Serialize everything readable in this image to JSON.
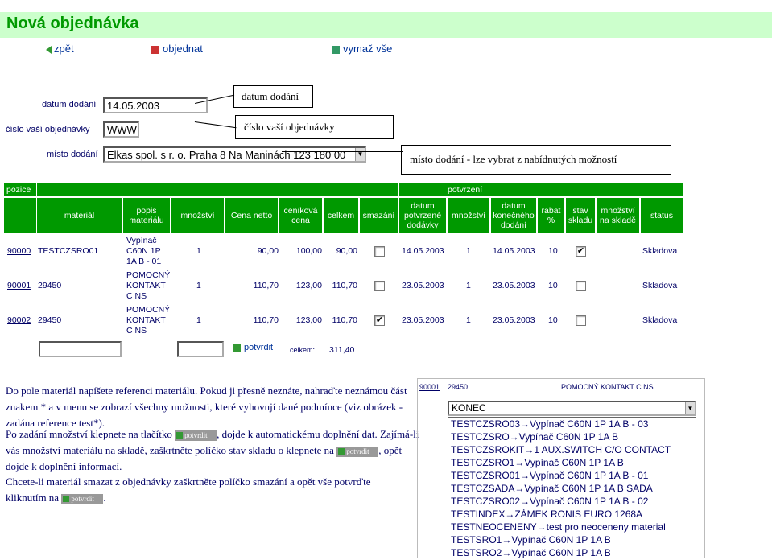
{
  "page": {
    "title": "Nová objednávka"
  },
  "toolbar": {
    "back": "zpět",
    "order": "objednat",
    "clear": "vymaž vše"
  },
  "form": {
    "delivery_date_label": "datum dodání",
    "delivery_date": "14.05.2003",
    "your_order_label": "číslo vaší objednávky",
    "your_order": "WWW",
    "place_label": "místo dodání",
    "place": "Elkas spol. s r. o. Praha 8 Na Maninách 123 180 00"
  },
  "callouts": {
    "date": "datum dodání",
    "order": "číslo vaší objednávky",
    "place": "místo dodání - lze vybrat z nabídnutých možností"
  },
  "table": {
    "header_top": {
      "pozice": "pozice",
      "potvrzeni": "potvrzení"
    },
    "columns": [
      "materiál",
      "popis materiálu",
      "množství",
      "Cena netto",
      "ceníková cena",
      "celkem",
      "smazání",
      "datum potvrzené dodávky",
      "množství",
      "datum konečného dodání",
      "rabat %",
      "stav skladu",
      "množství na skladě",
      "status"
    ],
    "rows": [
      {
        "pos": "90000",
        "mat": "TESTCZSRO01",
        "desc": [
          "Vypínač",
          "C60N 1P",
          "1A B - 01"
        ],
        "qty": "1",
        "net": "90,00",
        "list": "100,00",
        "total": "90,00",
        "del": false,
        "conf_date": "14.05.2003",
        "conf_qty": "1",
        "final_date": "14.05.2003",
        "rabat": "10",
        "stock": true,
        "status": "Skladova"
      },
      {
        "pos": "90001",
        "mat": "29450",
        "desc": [
          "POMOCNÝ",
          "KONTAKT",
          "C NS"
        ],
        "qty": "1",
        "net": "110,70",
        "list": "123,00",
        "total": "110,70",
        "del": false,
        "conf_date": "23.05.2003",
        "conf_qty": "1",
        "final_date": "23.05.2003",
        "rabat": "10",
        "stock": false,
        "status": "Skladova"
      },
      {
        "pos": "90002",
        "mat": "29450",
        "desc": [
          "POMOCNÝ",
          "KONTAKT",
          "C NS"
        ],
        "qty": "1",
        "net": "110,70",
        "list": "123,00",
        "total": "110,70",
        "del": true,
        "conf_date": "23.05.2003",
        "conf_qty": "1",
        "final_date": "23.05.2003",
        "rabat": "10",
        "stock": false,
        "status": "Skladova"
      }
    ],
    "confirm_label": "potvrdit",
    "total_label": "celkem:",
    "total_value": "311,40"
  },
  "help": {
    "p1": "Do pole materiál napíšete referenci materiálu. Pokud ji přesně neznáte, nahraďte neznámou část znakem * a v menu se zobrazí všechny možnosti, které vyhovují dané podmínce (viz obrázek -zadána reference test*).",
    "p2a": "Po zadání množství klepnete na tlačítko",
    "p2b": ", dojde k automatickému doplnění dat. Zajímá-li vás množství materiálu na skladě, zaškrtněte políčko stav skladu o klepnete na",
    "p2c": ", opět dojde k doplnění informací.",
    "p3a": "Chcete-li materiál smazat z objednávky zaškrtněte políčko smazání a opět vše potvrďte kliknutím na",
    "p3b": ".",
    "btn": "potvrdit"
  },
  "example": {
    "pos": "90001",
    "mat": "29450",
    "desc": "POMOCNÝ KONTAKT C NS",
    "select": "KONEC",
    "options": [
      "TESTCZSRO03→Vypínač C60N 1P 1A B - 03",
      "TESTCZSRO→Vypínač C60N 1P 1A B",
      "TESTCZSROKIT→1 AUX.SWITCH C/O CONTACT",
      "TESTCZSRO1→Vypínač C60N 1P 1A B",
      "TESTCZSRO01→Vypínač C60N 1P 1A B - 01",
      "TESTCZSADA→Vypínač C60N 1P 1A B SADA",
      "TESTCZSRO02→Vypínač C60N 1P 1A B - 02",
      "TESTINDEX→ZÁMEK RONIS EURO 1268A",
      "TESTNEOCENENY→test pro neoceneny material",
      "TESTSRO1→Vypínač C60N 1P 1A B",
      "TESTSRO2→Vypínač C60N 1P 1A B"
    ]
  }
}
